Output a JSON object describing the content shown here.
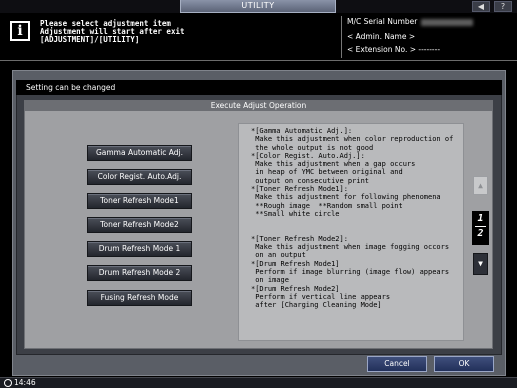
{
  "topbar": {
    "tab_title": "UTILITY",
    "icons": [
      "speaker-icon",
      "help-icon"
    ],
    "speaker_glyph": "◀",
    "help_glyph": "?"
  },
  "header": {
    "message_lines": [
      "Please select adjustment item",
      "Adjustment will start after exit",
      "[ADJUSTMENT]/[UTILITY]"
    ],
    "serial_label": "M/C Serial Number",
    "admin_label": "< Admin. Name >",
    "extension_label": "< Extension No. >",
    "extension_value": "--------"
  },
  "panel": {
    "status_text": "Setting can be changed",
    "dialog_title": "Execute Adjust Operation"
  },
  "buttons": [
    {
      "label": "Gamma Automatic Adj."
    },
    {
      "label": "Color Regist. Auto.Adj."
    },
    {
      "label": "Toner Refresh Mode1"
    },
    {
      "label": "Toner Refresh Mode2"
    },
    {
      "label": "Drum Refresh Mode 1"
    },
    {
      "label": "Drum Refresh Mode 2"
    },
    {
      "label": "Fusing Refresh Mode"
    }
  ],
  "description": "*[Gamma Automatic Adj.]:\n Make this adjustment when color reproduction of\n the whole output is not good\n*[Color Regist. Auto.Adj.]:\n Make this adjustment when a gap occurs\n in heap of YMC between original and\n output on consecutive print\n*[Toner Refresh Mode1]:\n Make this adjustment for following phenomena\n **Rough image  **Random small point\n **Small white circle\n\n\n*[Toner Refresh Mode2]:\n Make this adjustment when image fogging occors\n on an output\n*[Drum Refresh Mode1]\n Perform if image blurring (image flow) appears\n on image\n*[Drum Refresh Mode2]\n Perform if vertical line appears\n after [Charging Cleaning Mode]",
  "pagination": {
    "current": "1",
    "total": "2",
    "up_glyph": "▲",
    "down_glyph": "▼"
  },
  "footer": {
    "cancel_label": "Cancel",
    "ok_label": "OK"
  },
  "status": {
    "time": "14:46"
  }
}
